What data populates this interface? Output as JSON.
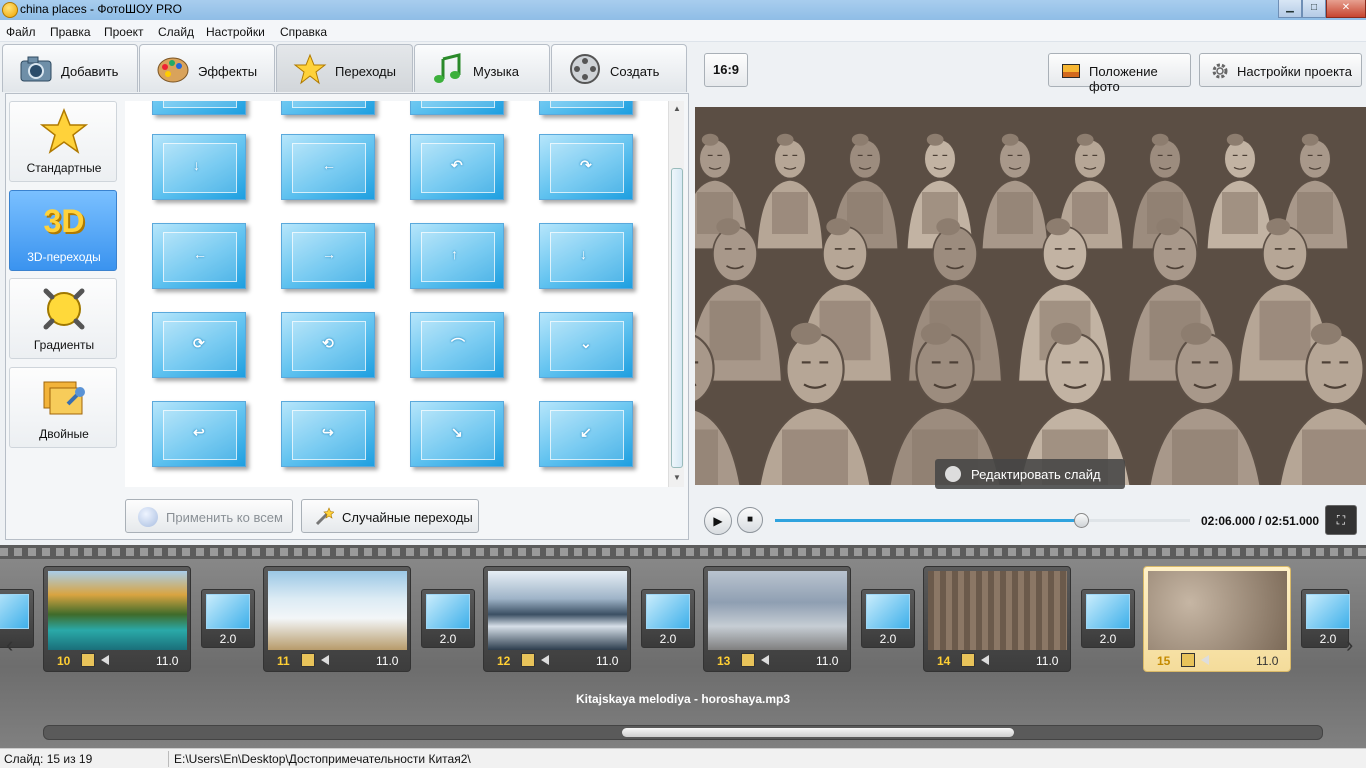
{
  "window": {
    "title": "china places - ФотоШОУ PRO",
    "minimize": "▁",
    "maximize": "□",
    "close": "✕"
  },
  "menu": [
    "Файл",
    "Правка",
    "Проект",
    "Слайд",
    "Настройки",
    "Справка"
  ],
  "tabs": [
    {
      "label": "Добавить",
      "icon": "camera-icon"
    },
    {
      "label": "Эффекты",
      "icon": "palette-icon"
    },
    {
      "label": "Переходы",
      "icon": "star-icon",
      "active": true
    },
    {
      "label": "Музыка",
      "icon": "music-note-icon"
    },
    {
      "label": "Создать",
      "icon": "film-reel-icon"
    }
  ],
  "categories": [
    {
      "label": "Стандартные",
      "icon": "star-icon"
    },
    {
      "label": "3D-переходы",
      "icon": "3d-text-icon",
      "glyph": "3D",
      "active": true
    },
    {
      "label": "Градиенты",
      "icon": "gradient-icon"
    },
    {
      "label": "Двойные",
      "icon": "double-pin-icon"
    }
  ],
  "transition_arrows": [
    "↓",
    "←",
    "↶",
    "↷",
    "←",
    "→",
    "↑",
    "↓",
    "⟳",
    "⟲",
    "⌒",
    "⌄",
    "↩",
    "↪",
    "↘",
    "↙"
  ],
  "buttons": {
    "apply_all": "Применить ко всем",
    "random": "Случайные переходы"
  },
  "preview": {
    "ratio": "16:9",
    "photo_position": "Положение фото",
    "project_settings": "Настройки проекта",
    "edit_slide": "Редактировать слайд",
    "play": "▶",
    "stop": "■",
    "fullscreen": "⛶",
    "timecode": "02:06.000 / 02:51.000",
    "progress": 0.737
  },
  "slides": [
    {
      "num": "10",
      "duration": "11.0",
      "scene": "forest-lake"
    },
    {
      "num": "11",
      "duration": "11.0",
      "scene": "waterfall"
    },
    {
      "num": "12",
      "duration": "11.0",
      "scene": "karst-river"
    },
    {
      "num": "13",
      "duration": "11.0",
      "scene": "blend"
    },
    {
      "num": "14",
      "duration": "11.0",
      "scene": "warriors-field"
    },
    {
      "num": "15",
      "duration": "11.0",
      "scene": "warriors",
      "active": true
    }
  ],
  "transitions_strip": [
    "2.0",
    "2.0",
    "2.0",
    "2.0",
    "2.0",
    "2.0"
  ],
  "audio_track": "Kitajskaya melodiya - horoshaya.mp3",
  "arrows": {
    "left": "‹",
    "right": "›"
  },
  "status": {
    "slide": "Слайд: 15 из 19",
    "path": "E:\\Users\\En\\Desktop\\Достопримечательности Китая2\\"
  }
}
